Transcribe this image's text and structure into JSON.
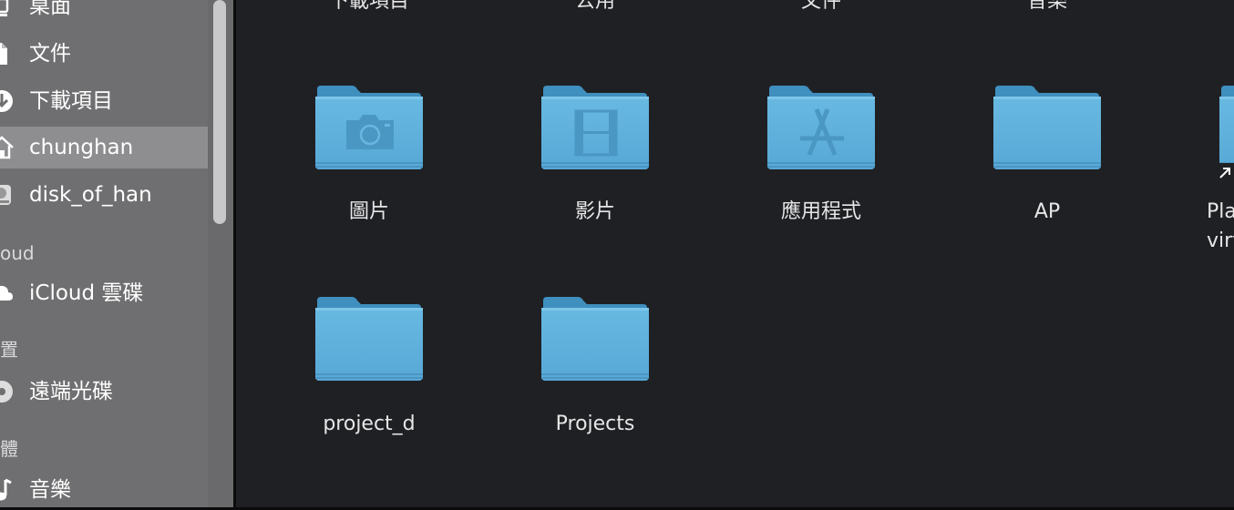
{
  "sidebar": {
    "items": [
      {
        "label": "桌面",
        "icon": "desktop-icon"
      },
      {
        "label": "文件",
        "icon": "document-icon"
      },
      {
        "label": "下載項目",
        "icon": "download-icon"
      },
      {
        "label": "chunghan",
        "icon": "home-icon",
        "selected": true
      },
      {
        "label": "disk_of_han",
        "icon": "disk-icon"
      },
      {
        "label": "iCloud 雲碟",
        "icon": "cloud-icon"
      },
      {
        "label": "遠端光碟",
        "icon": "disc-icon"
      },
      {
        "label": "音樂",
        "icon": "music-note-icon"
      }
    ],
    "sections": [
      "oud",
      "置",
      "體"
    ]
  },
  "main": {
    "top_labels": [
      "下載項目",
      "公用",
      "文件",
      "音樂"
    ],
    "row1": [
      {
        "label": "圖片",
        "icon": "camera-icon"
      },
      {
        "label": "影片",
        "icon": "film-icon"
      },
      {
        "label": "應用程式",
        "icon": "app-store-icon"
      },
      {
        "label": "AP",
        "icon": "folder-icon"
      },
      {
        "label_line1": "Pla",
        "label_line2": "virt",
        "icon": "alias-arrow-icon"
      }
    ],
    "row2": [
      {
        "label": "project_d",
        "icon": "folder-icon"
      },
      {
        "label": "Projects",
        "icon": "folder-icon"
      }
    ]
  },
  "colors": {
    "sidebar_bg": "#6f6f71",
    "sidebar_selected": "#8e8e90",
    "main_bg": "#1f2024",
    "folder_body": "#5fb0dc",
    "folder_tab": "#3f8fbf"
  }
}
